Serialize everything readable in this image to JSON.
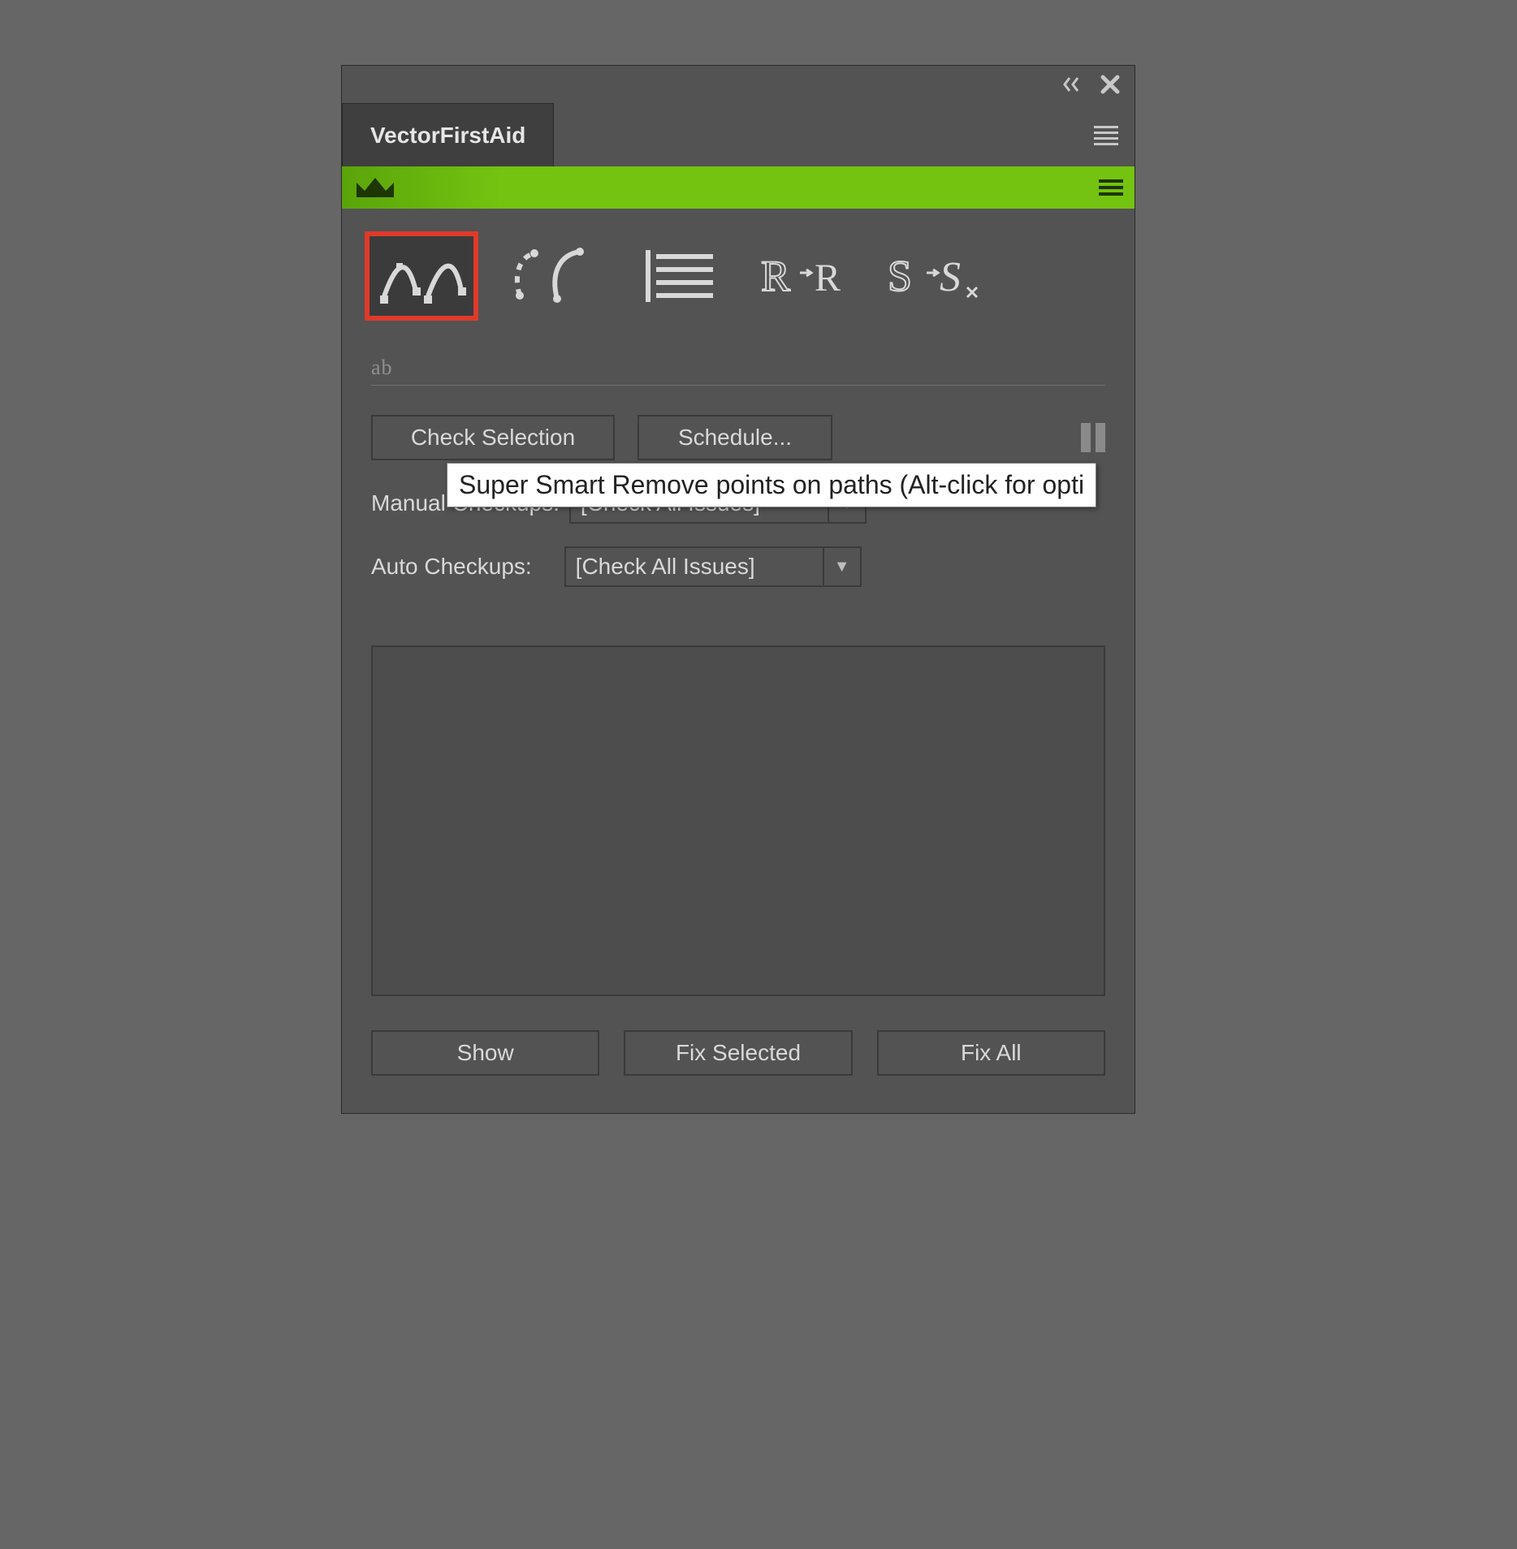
{
  "panel": {
    "title": "VectorFirstAid",
    "tooltip": "Super Smart Remove points on paths (Alt-click for opti",
    "secondary_label": "ab",
    "buttons": {
      "check_selection": "Check Selection",
      "schedule": "Schedule...",
      "show": "Show",
      "fix_selected": "Fix Selected",
      "fix_all": "Fix All"
    },
    "fields": {
      "manual_label": "Manual Checkups:",
      "manual_value": "[Check All Issues]",
      "auto_label": "Auto Checkups:",
      "auto_value": "[Check All Issues]"
    },
    "tool_icons": [
      "smart-remove-points-icon",
      "path-cleanup-icon",
      "align-lines-icon",
      "rr-tool-icon",
      "ss-tool-icon"
    ]
  }
}
